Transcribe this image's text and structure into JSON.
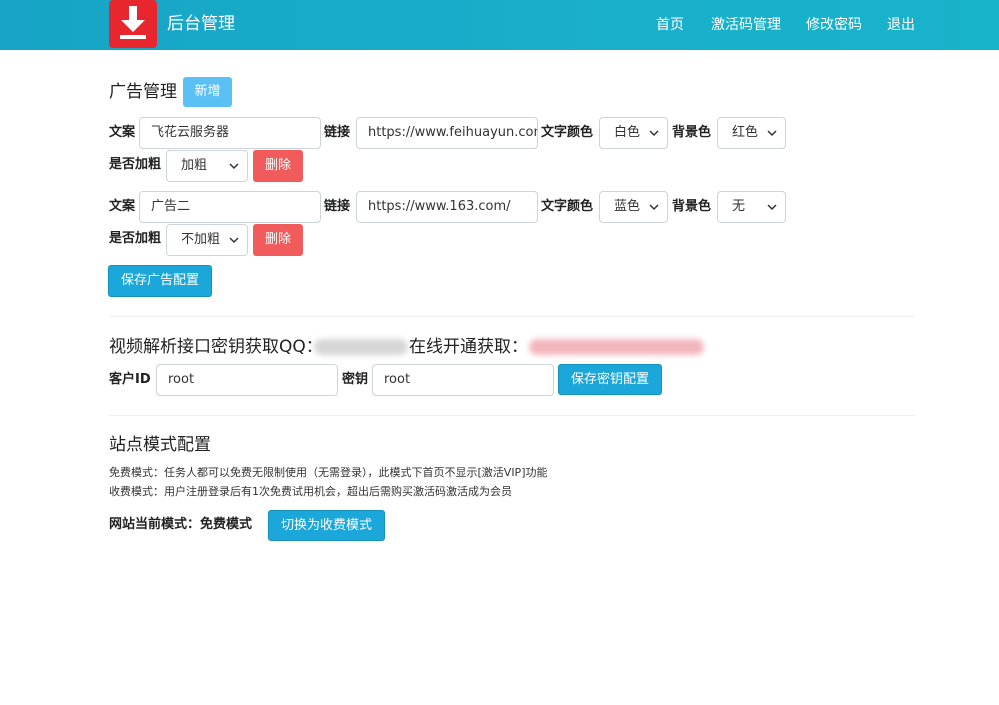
{
  "navbar": {
    "brand": "后台管理",
    "links": [
      "首页",
      "激活码管理",
      "修改密码",
      "退出"
    ]
  },
  "ads": {
    "title": "广告管理",
    "add_label": "新增",
    "labels": {
      "text": "文案",
      "link": "链接",
      "color": "文字颜色",
      "bg": "背景色",
      "bold": "是否加粗"
    },
    "items": [
      {
        "text": "飞花云服务器",
        "link": "https://www.feihuayun.com",
        "color": "白色",
        "bg": "红色",
        "bold": "加粗",
        "delete": "删除"
      },
      {
        "text": "广告二",
        "link": "https://www.163.com/",
        "color": "蓝色",
        "bg": "无",
        "bold": "不加粗",
        "delete": "删除"
      }
    ],
    "save_label": "保存广告配置"
  },
  "api": {
    "title_prefix": "视频解析接口密钥获取QQ：",
    "title_middle": "在线开通获取：",
    "client_id_label": "客户ID",
    "client_id": "root",
    "secret_label": "密钥",
    "secret": "root",
    "save_label": "保存密钥配置"
  },
  "mode": {
    "title": "站点模式配置",
    "free_desc": "免费模式：任务人都可以免费无限制使用（无需登录），此模式下首页不显示[激活VIP]功能",
    "paid_desc": "收费模式：用户注册登录后有1次免费试用机会，超出后需购买激活码激活成为会员",
    "current_label": "网站当前模式：免费模式",
    "switch_label": "切换为收费模式"
  },
  "colors": {
    "navbar": "#17a4c6",
    "danger": "#f25b5b",
    "info": "#5bc0f4",
    "primary": "#1ba7d9",
    "logo": "#e8262d"
  },
  "icons": {
    "logo": "download-icon",
    "select": "chevron-down-icon"
  }
}
